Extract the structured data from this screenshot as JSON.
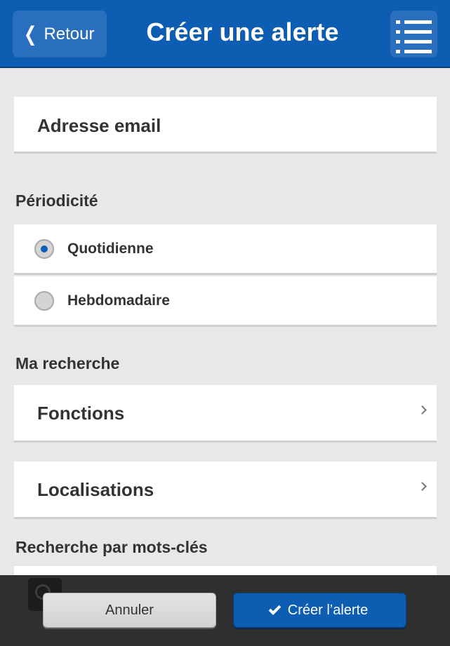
{
  "header": {
    "back_label": "Retour",
    "title": "Créer une alerte"
  },
  "form": {
    "email_label": "Adresse email",
    "periodicity": {
      "label": "Périodicité",
      "options": [
        {
          "label": "Quotidienne",
          "selected": true
        },
        {
          "label": "Hebdomadaire",
          "selected": false
        }
      ]
    },
    "search": {
      "label": "Ma recherche",
      "items": [
        {
          "label": "Fonctions"
        },
        {
          "label": "Localisations"
        }
      ]
    },
    "keywords_label": "Recherche par mots-clés"
  },
  "footer": {
    "cancel_label": "Annuler",
    "create_label": "Créer l’alerte"
  },
  "colors": {
    "accent": "#0d5db2",
    "background": "#e8e8e8",
    "footer": "#2f2f2f"
  },
  "icons": [
    "chevron-left-icon",
    "menu-icon",
    "chevron-right-icon",
    "search-icon",
    "check-icon"
  ]
}
